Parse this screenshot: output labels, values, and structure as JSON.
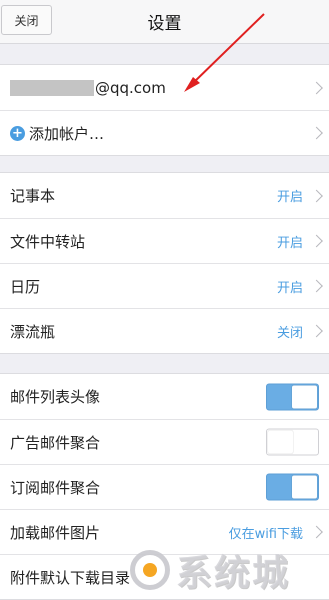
{
  "navbar": {
    "close_label": "关闭",
    "title": "设置"
  },
  "account": {
    "email_suffix": "@qq.com",
    "add_account_label": "添加帐户…"
  },
  "apps": [
    {
      "label": "记事本",
      "value": "开启"
    },
    {
      "label": "文件中转站",
      "value": "开启"
    },
    {
      "label": "日历",
      "value": "开启"
    },
    {
      "label": "漂流瓶",
      "value": "关闭"
    }
  ],
  "mail_settings": [
    {
      "label": "邮件列表头像",
      "toggle": "on"
    },
    {
      "label": "广告邮件聚合",
      "toggle": "off"
    },
    {
      "label": "订阅邮件聚合",
      "toggle": "on"
    },
    {
      "label": "加载邮件图片",
      "value": "仅在wifi下载"
    },
    {
      "label": "附件默认下载目录"
    }
  ],
  "watermark": {
    "text": "系统城"
  },
  "colors": {
    "accent": "#4a9de0",
    "toggle_on": "#6aade4",
    "arrow": "#e02020"
  }
}
